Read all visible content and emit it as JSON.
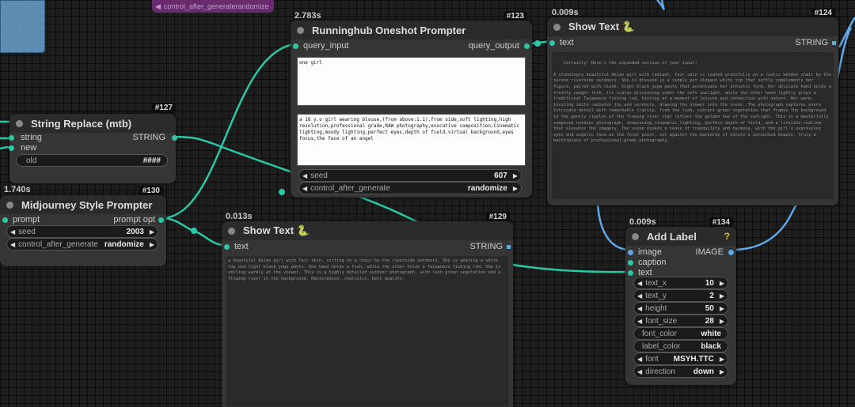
{
  "colors": {
    "accent": "#2bc8a8",
    "image_link": "#60a8e8"
  },
  "top_ghost": {
    "label": "control_after_generate",
    "value": "randomize"
  },
  "string_replace": {
    "badge": "#127",
    "title": "String Replace (mtb)",
    "inputs": [
      "string",
      "new"
    ],
    "output": "STRING",
    "widget": {
      "label": "old",
      "value": "####"
    }
  },
  "midjourney": {
    "time": "1.740s",
    "badge": "#130",
    "title": "Midjourney Style Prompter",
    "input": "prompt",
    "output": "prompt opt",
    "seed": {
      "label": "seed",
      "value": "2003"
    },
    "cag": {
      "label": "control_after_generate",
      "value": "randomize"
    }
  },
  "runninghub": {
    "time": "2.783s",
    "badge": "#123",
    "title": "Runninghub Oneshot Prompter",
    "input": "query_input",
    "output": "query_output",
    "query_text": "one girl",
    "system_text": "a 18 y.o girl wearing blouse,(from above:1.1),from side,soft lighting,high resolution,professional grade,RAW photography,evocative composition,Cinematic lighting,moody lighting,perfect eyes,depth of field,virtual background,eyes focus,the face of an angel",
    "seed": {
      "label": "seed",
      "value": "607"
    },
    "cag": {
      "label": "control_after_generate",
      "value": "randomize"
    }
  },
  "show_text_124": {
    "time": "0.009s",
    "badge": "#124",
    "title": "Show Text 🐍",
    "input": "text",
    "output": "STRING",
    "text": "Certainly! Here's the expanded version of your input:\n\nA stunningly beautiful Asian girl with radiant, fair skin is seated gracefully on a rustic wooden chair by the serene riverside outdoors. She is dressed in a simple yet elegant white top that softly complements her figure, paired with sleek, tight black yoga pants that accentuate her athletic form. Her delicate hand holds a freshly caught fish, its scales glistening under the soft sunlight, while the other hand lightly grips a traditional Taiwanese fishing rod, hinting at a moment of leisure and connection with nature. Her warm, inviting smile radiates joy and serenity, drawing the viewer into the scene. The photograph captures every intricate detail with remarkable clarity, from the lush, vibrant green vegetation that frames the background to the gentle ripples of the flowing river that reflect the golden hue of the sunlight. This is a masterfully composed outdoor photograph, showcasing cinematic lighting, perfect depth of field, and a lifelike realism that elevates the imagery. The scene evokes a sense of tranquility and harmony, with the girl's expressive eyes and angelic face as the focal point, set against the backdrop of nature's untouched beauty. Truly a masterpiece of professional-grade photography."
  },
  "show_text_129": {
    "time": "0.013s",
    "badge": "#129",
    "title": "Show Text 🐍",
    "input": "text",
    "output": "STRING",
    "text": "a beautiful Asian girl with fair skin, sitting on a chair by the riverside outdoors. She is wearing a white top and tight black yoga pants. One hand holds a fish, while the other holds a Taiwanese fishing rod. She is smiling warmly at the viewer. This is a highly detailed outdoor photograph, with lush green vegetation and a flowing river in the background. Masterpiece, realistic, best quality."
  },
  "add_label": {
    "time": "0.009s",
    "badge": "#134",
    "title": "Add Label",
    "help": "?",
    "inputs": [
      "image",
      "caption",
      "text"
    ],
    "output": "IMAGE",
    "widgets": [
      {
        "label": "text_x",
        "value": "10"
      },
      {
        "label": "text_y",
        "value": "2"
      },
      {
        "label": "height",
        "value": "50"
      },
      {
        "label": "font_size",
        "value": "28"
      },
      {
        "label": "font_color",
        "value": "white"
      },
      {
        "label": "label_color",
        "value": "black"
      },
      {
        "label": "font",
        "value": "MSYH.TTC"
      },
      {
        "label": "direction",
        "value": "down"
      }
    ]
  }
}
